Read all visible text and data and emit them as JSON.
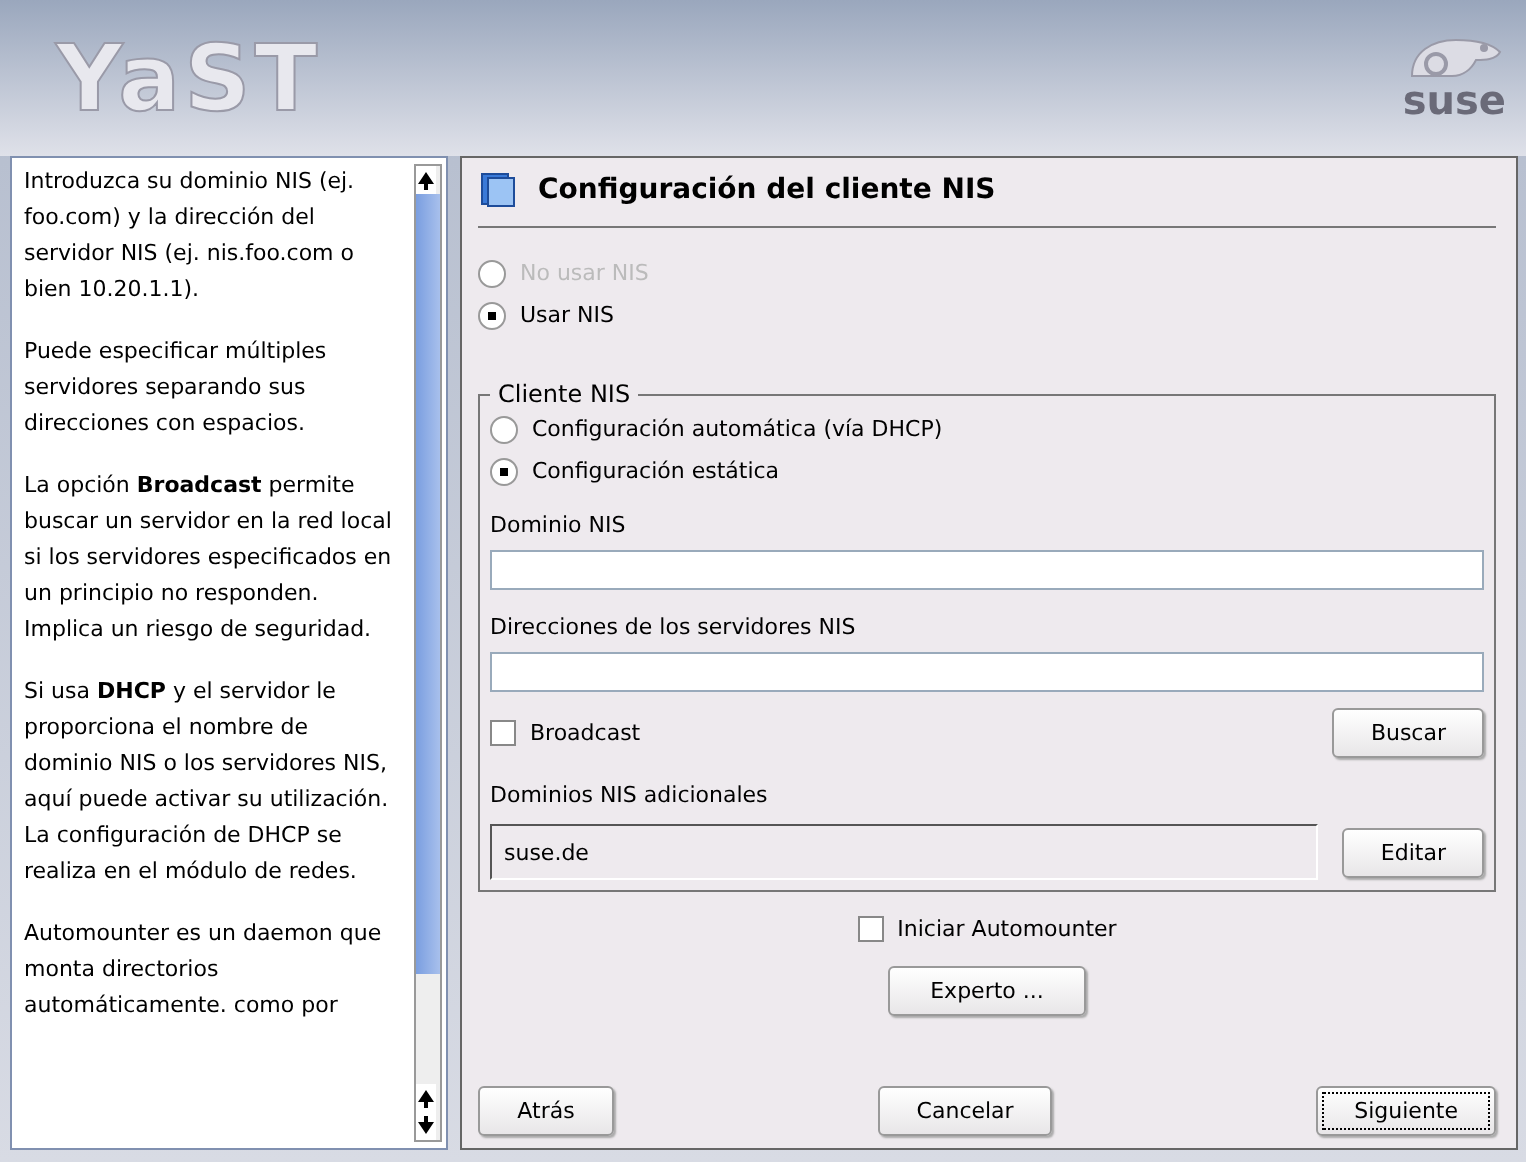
{
  "header": {
    "logo": "YaST",
    "brand": "suse"
  },
  "help": {
    "paragraphs": [
      "Introduzca su dominio NIS (ej. foo.com) y la dirección del servidor NIS (ej. nis.foo.com o bien 10.20.1.1).",
      "Puede especificar múltiples servidores separando sus direcciones con espacios.",
      "La opción **Broadcast** permite buscar un servidor en la red local si los servidores especificados en un principio no responden. Implica un riesgo de seguridad.",
      "Si usa **DHCP** y el servidor le proporciona el nombre de dominio NIS o los servidores NIS, aquí puede activar su utilización. La configuración de DHCP se realiza en el módulo de redes.",
      "Automounter es un daemon que monta directorios automáticamente. como por"
    ]
  },
  "dialog": {
    "title": "Configuración del cliente NIS",
    "use_nis": [
      {
        "label": "No usar NIS",
        "selected": false,
        "disabled": true
      },
      {
        "label": "Usar NIS",
        "selected": true,
        "disabled": false
      }
    ],
    "group": {
      "title": "Cliente NIS",
      "mode": [
        {
          "label": "Configuración automática (vía DHCP)",
          "selected": false
        },
        {
          "label": "Configuración estática",
          "selected": true
        }
      ],
      "domain": {
        "label": "Dominio NIS"
      },
      "servers": {
        "label": "Direcciones de los servidores NIS"
      },
      "broadcast": {
        "label": "Broadcast",
        "checked": false
      },
      "find_button": "Buscar",
      "additional": {
        "label": "Dominios NIS adicionales",
        "value": "suse.de"
      },
      "edit_button": "Editar"
    },
    "automounter": {
      "label": "Iniciar Automounter",
      "checked": false
    },
    "expert_button": "Experto ...",
    "buttons": [
      "Atrás",
      "Cancelar",
      "Siguiente"
    ]
  }
}
